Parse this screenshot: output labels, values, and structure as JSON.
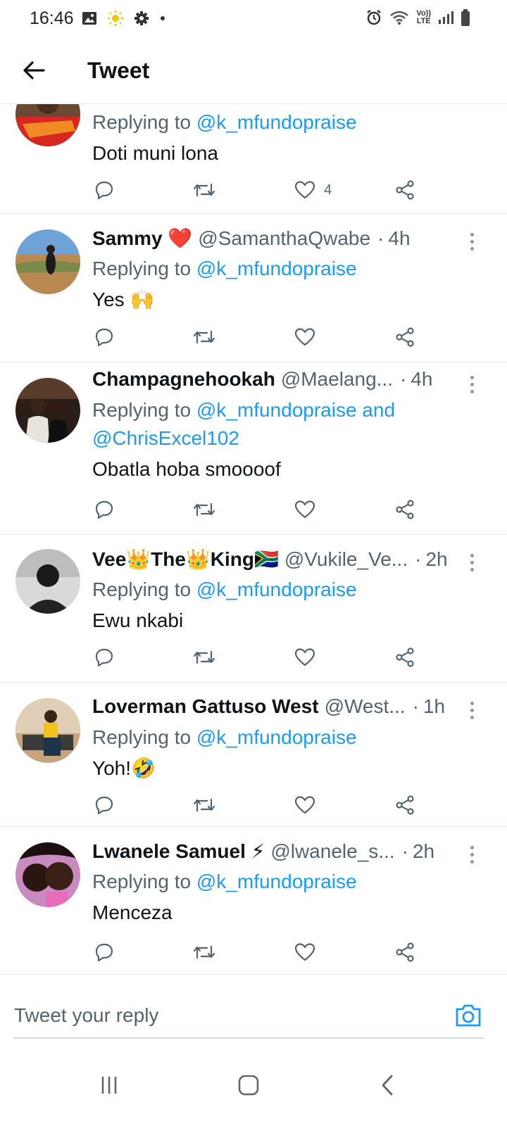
{
  "status_bar": {
    "time": "16:46",
    "left_icons": [
      "image-icon",
      "brightness-icon",
      "gear-icon",
      "dot-icon"
    ],
    "right_icons": [
      "alarm-icon",
      "wifi-icon",
      "volte-icon",
      "signal-icon",
      "battery-icon"
    ],
    "volte_label_top": "Vo))",
    "volte_label_bottom": "LTE"
  },
  "header": {
    "title": "Tweet",
    "back_icon": "back-arrow-icon"
  },
  "replies": [
    {
      "name": "",
      "handle": "",
      "time": "",
      "replying_label": "Replying to",
      "replying_to": "@k_mfundopraise",
      "text": "Doti muni lona",
      "like_count": "4"
    },
    {
      "name": "Sammy ❤️",
      "handle": "@SamanthaQwabe",
      "time": "4h",
      "replying_label": "Replying to",
      "replying_to": "@k_mfundopraise",
      "text": "Yes 🙌",
      "like_count": ""
    },
    {
      "name": "Champagnehookah",
      "handle": "@Maelang...",
      "time": "4h",
      "replying_label": "Replying to",
      "replying_to": "@k_mfundopraise and @ChrisExcel102",
      "text": "Obatla hoba smoooof",
      "like_count": ""
    },
    {
      "name": "Vee👑The👑King🇿🇦",
      "handle": "@Vukile_Ve...",
      "time": "2h",
      "replying_label": "Replying to",
      "replying_to": "@k_mfundopraise",
      "text": "Ewu nkabi",
      "like_count": ""
    },
    {
      "name": "Loverman Gattuso West",
      "handle": "@West...",
      "time": "1h",
      "replying_label": "Replying to",
      "replying_to": "@k_mfundopraise",
      "text": "Yoh!🤣",
      "like_count": ""
    },
    {
      "name": "Lwanele Samuel ⚡",
      "handle": "@lwanele_s...",
      "time": "2h",
      "replying_label": "Replying to",
      "replying_to": "@k_mfundopraise",
      "text": "Menceza",
      "like_count": ""
    }
  ],
  "reply_composer": {
    "placeholder": "Tweet your reply",
    "camera_icon": "camera-icon"
  },
  "nav_bar": {
    "icons": [
      "recents-icon",
      "home-icon",
      "back-icon"
    ]
  },
  "colors": {
    "accent": "#1d9bf0",
    "text_primary": "#0f1419",
    "text_secondary": "#536471",
    "divider": "#e6e9ec"
  }
}
